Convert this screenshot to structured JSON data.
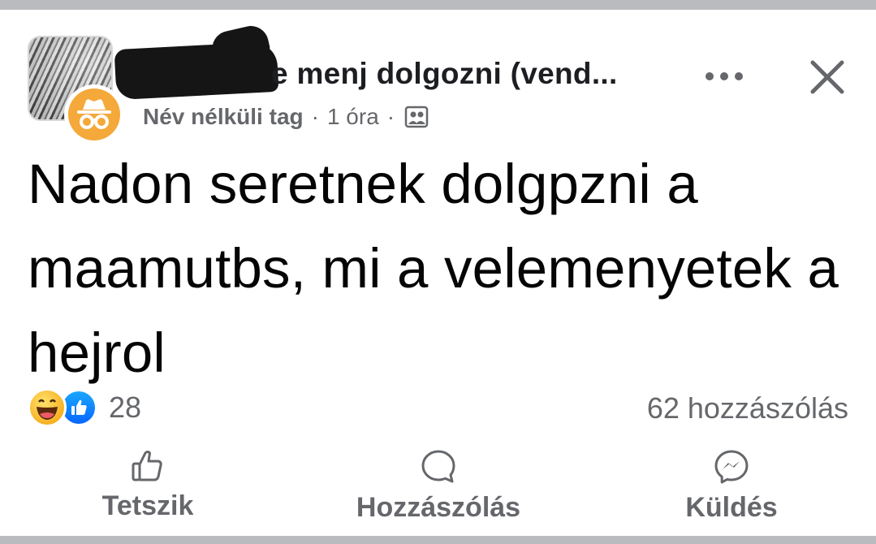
{
  "post": {
    "group_name": "e menj dolgozni (vend...",
    "author_role": "Név nélküli tag",
    "separator": "·",
    "time": "1 óra",
    "text": "Nadon seretnek dolgpzni a maamutbs, mi a velemenyetek a hejrol",
    "icons": {
      "anonymous": "incognito-icon",
      "privacy": "group-members-icon",
      "more": "ellipsis-icon",
      "close": "close-icon"
    }
  },
  "stats": {
    "reaction_count": "28",
    "reactions": [
      "haha",
      "like"
    ],
    "comment_count": "62 hozzászólás"
  },
  "actions": {
    "like_label": "Tetszik",
    "comment_label": "Hozzászólás",
    "send_label": "Küldés"
  },
  "colors": {
    "secondary_text": "#65676b",
    "like_blue": "#0866ff",
    "haha_yellow": "#f7b125",
    "anon_orange": "#f4a93a",
    "background_border": "#b9bbbe"
  }
}
